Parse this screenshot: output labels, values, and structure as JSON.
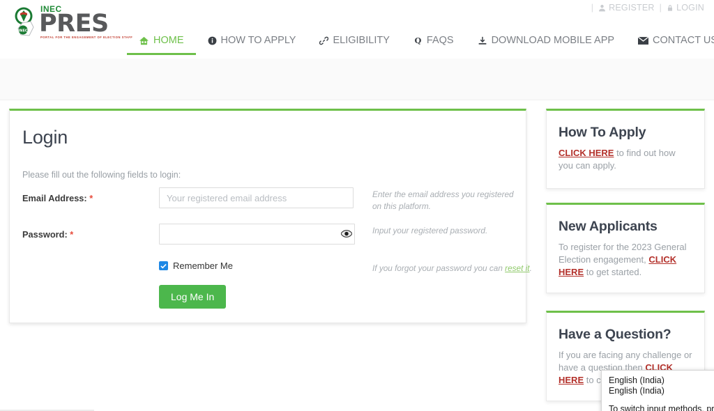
{
  "topbar": {
    "separator": "|",
    "links": [
      {
        "label": "REGISTER",
        "icon": "user-icon"
      },
      {
        "label": "LOGIN",
        "icon": "lock-icon"
      }
    ]
  },
  "brand": {
    "inec": "INEC",
    "pres": "PRES",
    "tagline": "PORTAL FOR THE ENGAGEMENT OF ELECTION STAFF",
    "green": "#1f8a36",
    "gray": "#58595b",
    "red": "#c0392b"
  },
  "nav": {
    "active_color": "#6ec04a",
    "items": [
      {
        "label": "HOME",
        "icon": "home-icon",
        "active": true
      },
      {
        "label": "HOW TO APPLY",
        "icon": "info-circle-icon",
        "active": false
      },
      {
        "label": "ELIGIBILITY",
        "icon": "link-icon",
        "active": false
      },
      {
        "label": "FAQS",
        "icon": "question-q-icon",
        "active": false
      },
      {
        "label": "DOWNLOAD MOBILE APP",
        "icon": "download-icon",
        "active": false
      },
      {
        "label": "CONTACT US",
        "icon": "envelope-icon",
        "active": false
      }
    ]
  },
  "login": {
    "title": "Login",
    "subtitle": "Please fill out the following fields to login:",
    "email": {
      "label": "Email Address:",
      "required_mark": "*",
      "placeholder": "Your registered email address",
      "value": "",
      "help": "Enter the email address you registered on this platform."
    },
    "password": {
      "label": "Password:",
      "required_mark": "*",
      "placeholder": "",
      "value": "",
      "help": "Input your registered password.",
      "toggle_icon": "eye-icon"
    },
    "remember": {
      "label": "Remember Me",
      "checked": true,
      "color": "#1e88e5"
    },
    "forgot": {
      "text_before": "If you forgot your password you can ",
      "link": "reset it",
      "text_after": "."
    },
    "submit_label": "Log Me In",
    "submit_color": "#4cb74c"
  },
  "sidebar": {
    "cards": [
      {
        "title": "How To Apply",
        "link": "CLICK HERE",
        "text_before": "",
        "text_after": " to find out how you can apply."
      },
      {
        "title": "New Applicants",
        "link": "CLICK HERE",
        "text_before": "To register for the 2023 General Election engagement, ",
        "text_after": " to get started."
      },
      {
        "title": "Have a Question?",
        "link": "CLICK HERE",
        "text_before": "If you are facing any challenge or have a question then ",
        "text_after": " to contact us."
      }
    ],
    "link_color": "#b3302a"
  },
  "ime_popup": {
    "options": [
      "English (India)",
      "English (India)"
    ],
    "hint": "To switch input methods, press W"
  }
}
